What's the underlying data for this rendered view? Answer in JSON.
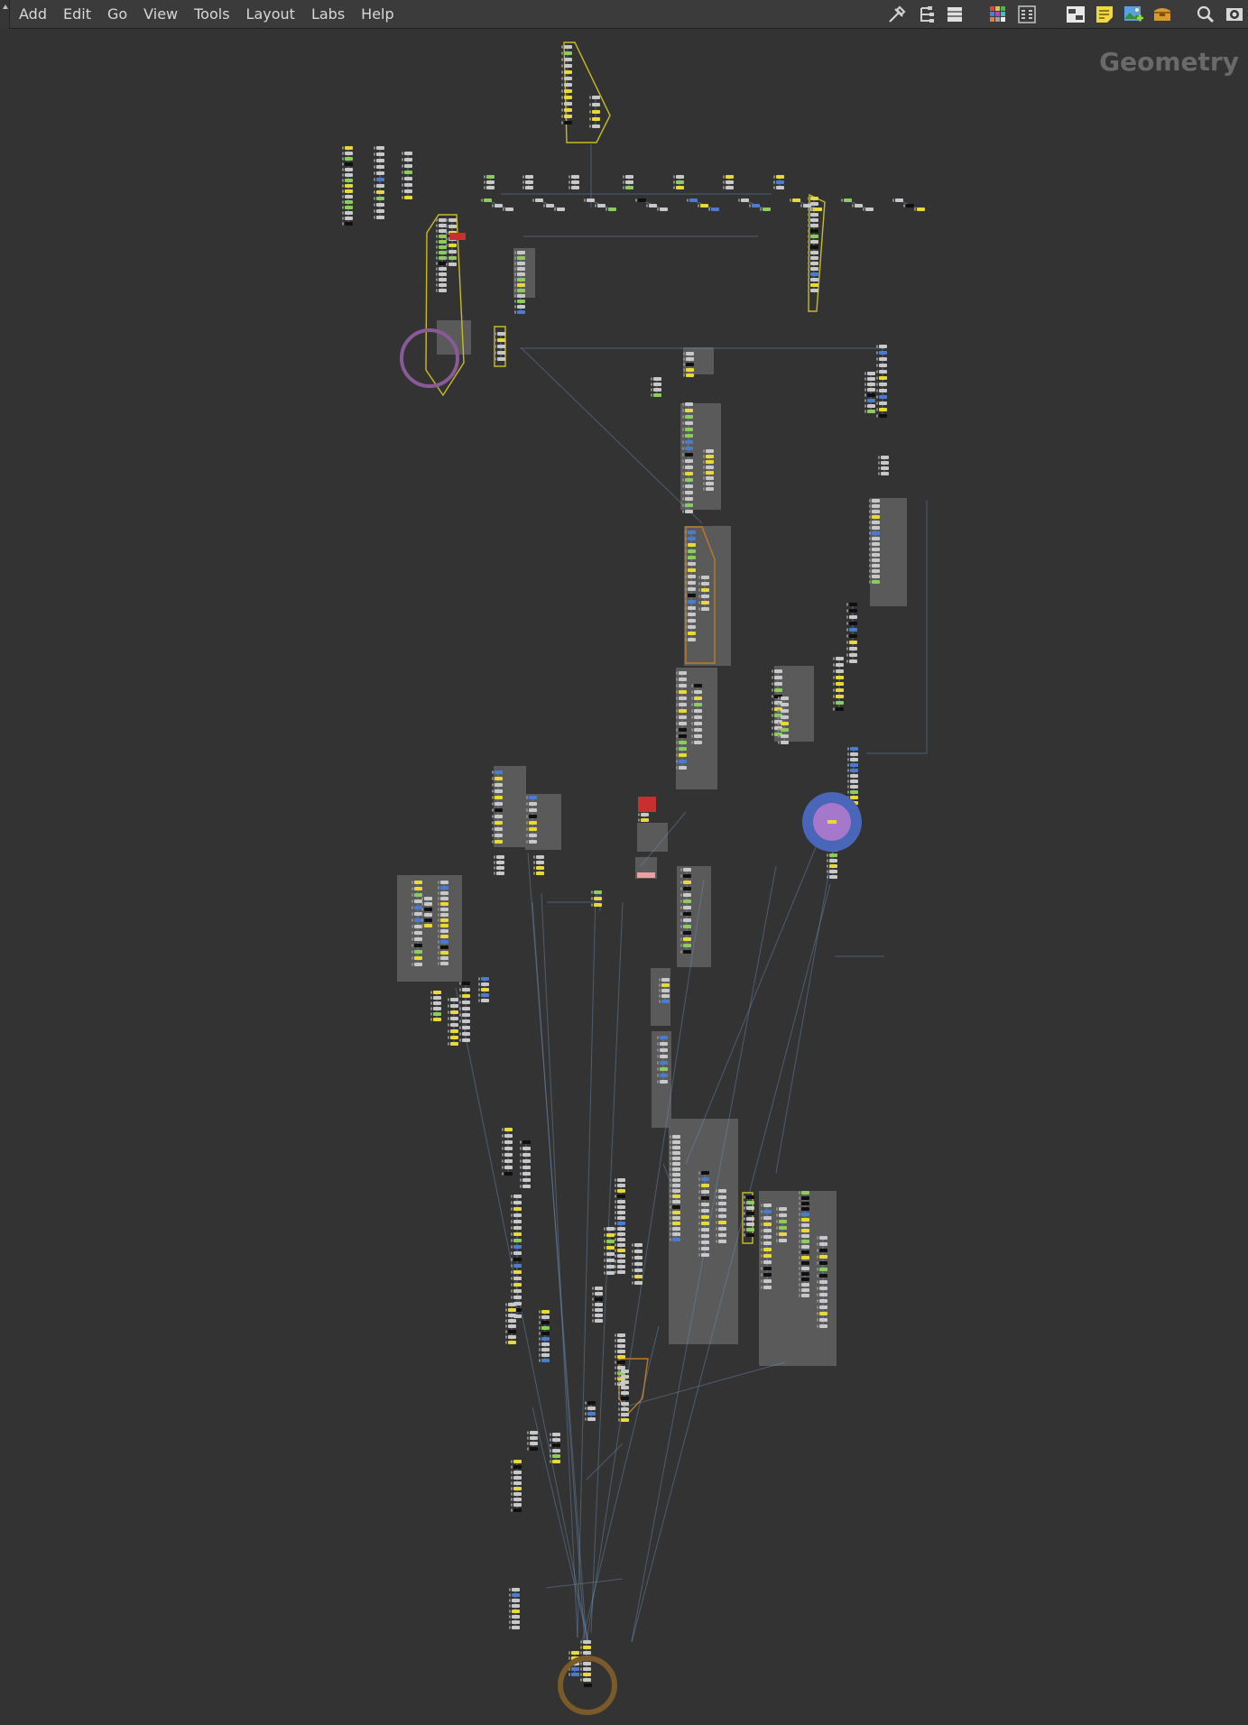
{
  "menu": {
    "items": [
      "Add",
      "Edit",
      "Go",
      "View",
      "Tools",
      "Layout",
      "Labs",
      "Help"
    ]
  },
  "toolbar": {
    "icons": [
      "wrench-icon",
      "tree-icon",
      "list-icon",
      "color-palette-icon",
      "shape-palette-icon",
      "network-overview-icon",
      "sticky-note-icon",
      "background-image-icon",
      "box-icon",
      "search-icon",
      "eye-icon"
    ]
  },
  "network": {
    "context_label": "Geometry"
  },
  "colors": {
    "background": "#333333",
    "menubar": "#3b3b3b",
    "node_default": "#c8c8c8",
    "node_yellow": "#e8d838",
    "node_black": "#101010",
    "node_green": "#8ccc5a",
    "node_blue": "#4a7bd0",
    "node_red": "#c83030",
    "wire": "#6e8fb8",
    "box": "#5d5d5d",
    "netbox_yellow": "#c9bb22",
    "netbox_orange": "#c07a20"
  }
}
